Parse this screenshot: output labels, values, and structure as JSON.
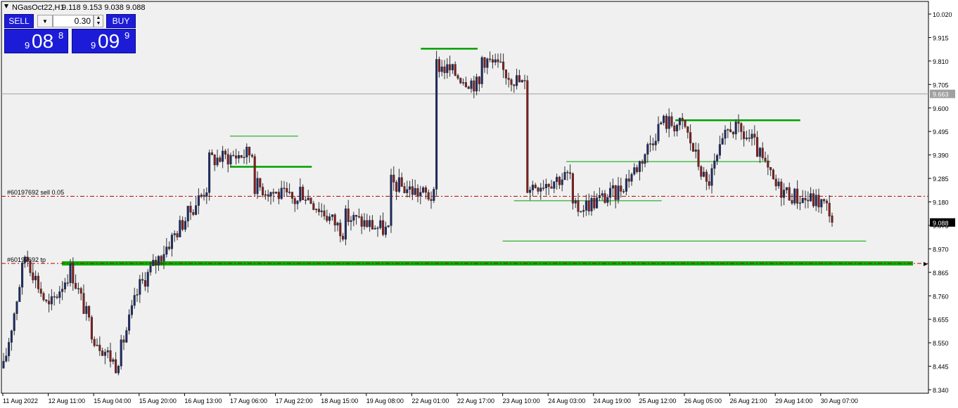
{
  "header": {
    "title": "NGasOct22,H1",
    "ohlc": "9.118 9.153 9.038 9.088"
  },
  "trade_panel": {
    "sell_label": "SELL",
    "buy_label": "BUY",
    "lot": "0.30",
    "sell_price": {
      "prefix": "9",
      "big": "08",
      "sup": "8"
    },
    "buy_price": {
      "prefix": "9",
      "big": "09",
      "sup": "9"
    }
  },
  "order_labels": {
    "sell": "#60197692 sell 0.05",
    "tp": "#60197692 tp"
  },
  "price_axis": {
    "ticks": [
      "10.020",
      "9.915",
      "9.810",
      "9.705",
      "9.600",
      "9.495",
      "9.390",
      "9.285",
      "9.180",
      "9.075",
      "8.970",
      "8.865",
      "8.760",
      "8.655",
      "8.550",
      "8.445",
      "8.340"
    ],
    "hline_label": "9.663",
    "current_label": "9.088"
  },
  "time_axis": {
    "labels": [
      "11 Aug 2022",
      "12 Aug 11:00",
      "15 Aug 04:00",
      "15 Aug 20:00",
      "16 Aug 13:00",
      "17 Aug 06:00",
      "17 Aug 22:00",
      "18 Aug 15:00",
      "19 Aug 08:00",
      "22 Aug 01:00",
      "22 Aug 17:00",
      "23 Aug 10:00",
      "24 Aug 03:00",
      "24 Aug 19:00",
      "25 Aug 12:00",
      "26 Aug 05:00",
      "26 Aug 21:00",
      "29 Aug 14:00",
      "30 Aug 07:00"
    ]
  },
  "colors": {
    "background": "#f0f0f0",
    "bull_candle": "#1a2a6c",
    "bear_candle": "#8b1a1a",
    "order_line": "#c00000",
    "tp_line": "#00b000",
    "level_line": "#00a000",
    "hline": "#a0a0a0",
    "button": "#1c1cd8"
  },
  "chart_data": {
    "type": "candlestick",
    "symbol": "NGasOct22",
    "timeframe": "H1",
    "ylim": [
      8.34,
      10.02
    ],
    "ohlc_last": {
      "open": 9.118,
      "high": 9.153,
      "low": 9.038,
      "close": 9.088
    },
    "horizontal_line": 9.663,
    "sell_order_price": 9.205,
    "take_profit_price": 8.905,
    "current_price": 9.088,
    "levels": [
      {
        "from": "17 Aug 06:00",
        "to": "17 Aug 22:00",
        "price": 9.337
      },
      {
        "from": "17 Aug 06:00",
        "to": "17 Aug 22:00",
        "price": 9.474
      },
      {
        "from": "22 Aug 01:00",
        "to": "22 Aug 17:00",
        "price": 9.865
      },
      {
        "from": "23 Aug 10:00",
        "to": "30 Aug 07:00",
        "price": 9.005
      },
      {
        "from": "24 Aug 03:00",
        "to": "26 Aug 21:00",
        "price": 9.36
      },
      {
        "from": "23 Aug 10:00",
        "to": "25 Aug 12:00",
        "price": 9.185
      },
      {
        "from": "25 Aug 12:00",
        "to": "29 Aug 14:00",
        "price": 9.545
      }
    ],
    "close_path": [
      [
        "11 Aug 2022",
        8.42
      ],
      [
        "11 Aug 2022",
        8.95
      ],
      [
        "12 Aug 11:00",
        8.7
      ],
      [
        "12 Aug 11:00",
        8.88
      ],
      [
        "15 Aug 04:00",
        8.58
      ],
      [
        "15 Aug 04:00",
        8.45
      ],
      [
        "15 Aug 20:00",
        8.8
      ],
      [
        "16 Aug 13:00",
        9.25
      ],
      [
        "16 Aug 13:00",
        9.35
      ],
      [
        "17 Aug 06:00",
        9.4
      ],
      [
        "17 Aug 06:00",
        9.3
      ],
      [
        "17 Aug 22:00",
        9.18
      ],
      [
        "17 Aug 22:00",
        9.34
      ],
      [
        "18 Aug 15:00",
        9.05
      ],
      [
        "18 Aug 15:00",
        9.15
      ],
      [
        "19 Aug 08:00",
        9.05
      ],
      [
        "19 Aug 08:00",
        9.3
      ],
      [
        "22 Aug 01:00",
        9.2
      ],
      [
        "22 Aug 01:00",
        9.85
      ],
      [
        "22 Aug 17:00",
        9.7
      ],
      [
        "22 Aug 17:00",
        9.9
      ],
      [
        "23 Aug 10:00",
        9.7
      ],
      [
        "23 Aug 10:00",
        9.22
      ],
      [
        "24 Aug 03:00",
        9.3
      ],
      [
        "24 Aug 03:00",
        9.1
      ],
      [
        "24 Aug 19:00",
        9.22
      ],
      [
        "25 Aug 12:00",
        9.35
      ],
      [
        "25 Aug 12:00",
        9.54
      ],
      [
        "26 Aug 05:00",
        9.52
      ],
      [
        "26 Aug 05:00",
        9.25
      ],
      [
        "26 Aug 21:00",
        9.52
      ],
      [
        "26 Aug 21:00",
        9.45
      ],
      [
        "29 Aug 14:00",
        9.25
      ],
      [
        "29 Aug 14:00",
        9.2
      ],
      [
        "30 Aug 07:00",
        9.18
      ],
      [
        "30 Aug 07:00",
        9.088
      ]
    ]
  }
}
